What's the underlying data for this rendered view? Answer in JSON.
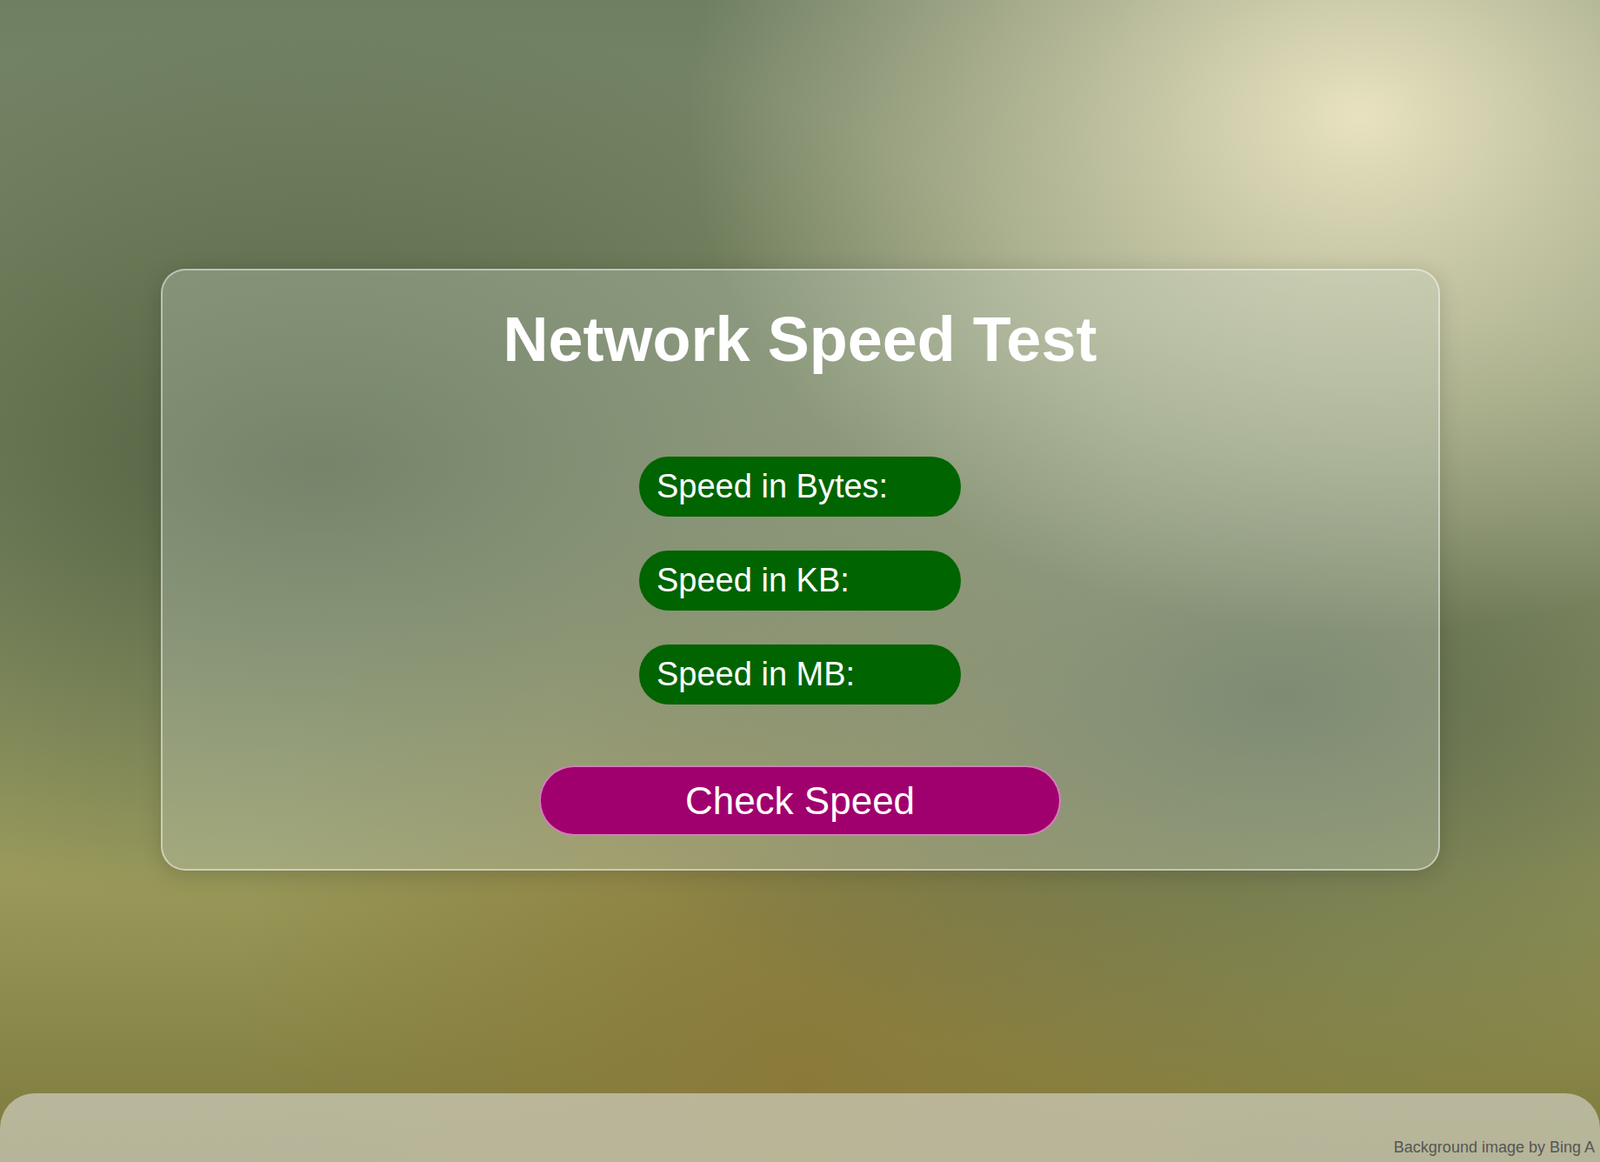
{
  "window": {
    "title": "Network Speed Test"
  },
  "speed_fields": [
    {
      "label": "Speed in Bytes:",
      "value": ""
    },
    {
      "label": "Speed in KB:",
      "value": ""
    },
    {
      "label": "Speed in MB:",
      "value": ""
    }
  ],
  "buttons": [
    "Check Speed"
  ],
  "footer": {
    "credit": "Background image by Bing A"
  }
}
